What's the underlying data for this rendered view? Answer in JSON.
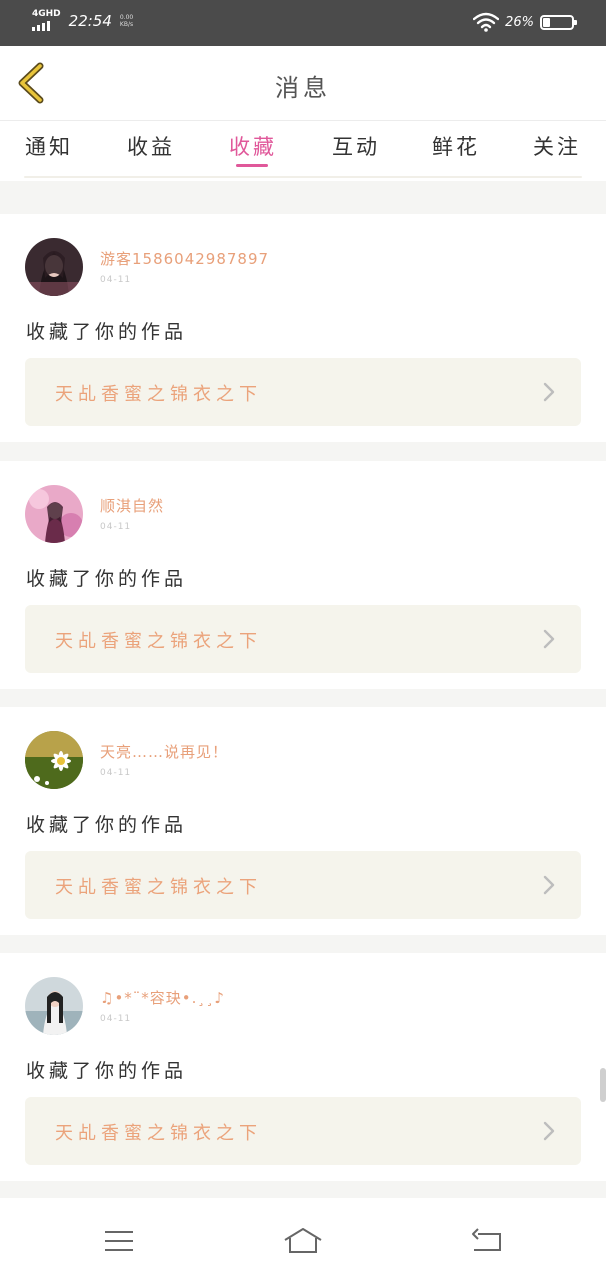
{
  "status_bar": {
    "network_label": "4GHD",
    "time": "22:54",
    "speed_value": "0.00",
    "speed_unit": "KB/s",
    "battery_percent": "26%",
    "battery_level": 0.26
  },
  "header": {
    "back_icon": "chevron-left-icon",
    "title": "消息"
  },
  "tabs": [
    {
      "label": "通知",
      "active": false
    },
    {
      "label": "收益",
      "active": false
    },
    {
      "label": "收藏",
      "active": true
    },
    {
      "label": "互动",
      "active": false
    },
    {
      "label": "鲜花",
      "active": false
    },
    {
      "label": "关注",
      "active": false
    }
  ],
  "colors": {
    "accent": "#e0589a",
    "username": "#e8a07a",
    "work_title": "#eba37b",
    "work_bg": "#f5f4ec",
    "status_bar_bg": "#4b4b4b"
  },
  "messages": [
    {
      "username": "游客1586042987897",
      "date": "04-11",
      "action": "收藏了你的作品",
      "work_title": "天乩香蜜之锦衣之下"
    },
    {
      "username": "顺淇自然",
      "date": "04-11",
      "action": "收藏了你的作品",
      "work_title": "天乩香蜜之锦衣之下"
    },
    {
      "username": "天亮……说再见！",
      "date": "04-11",
      "action": "收藏了你的作品",
      "work_title": "天乩香蜜之锦衣之下"
    },
    {
      "username": "♫•*¨*容玦•.¸¸♪",
      "date": "04-11",
      "action": "收藏了你的作品",
      "work_title": "天乩香蜜之锦衣之下"
    }
  ],
  "nav_bar": {
    "menu_icon": "menu-icon",
    "home_icon": "home-icon",
    "back_icon": "return-icon"
  }
}
